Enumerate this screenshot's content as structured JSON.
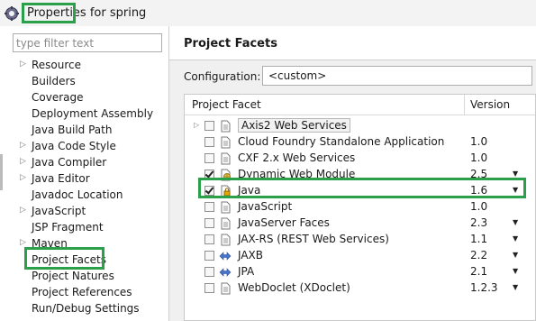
{
  "window": {
    "title": "Properties for spring",
    "icon": "eclipse-gear-icon"
  },
  "left_pane": {
    "filter_placeholder": "type filter text",
    "items": [
      {
        "label": "Resource",
        "expandable": true
      },
      {
        "label": "Builders",
        "expandable": false
      },
      {
        "label": "Coverage",
        "expandable": false
      },
      {
        "label": "Deployment Assembly",
        "expandable": false
      },
      {
        "label": "Java Build Path",
        "expandable": false
      },
      {
        "label": "Java Code Style",
        "expandable": true
      },
      {
        "label": "Java Compiler",
        "expandable": true
      },
      {
        "label": "Java Editor",
        "expandable": true
      },
      {
        "label": "Javadoc Location",
        "expandable": false
      },
      {
        "label": "JavaScript",
        "expandable": true
      },
      {
        "label": "JSP Fragment",
        "expandable": false
      },
      {
        "label": "Maven",
        "expandable": true
      },
      {
        "label": "Project Facets",
        "expandable": false,
        "selected": true
      },
      {
        "label": "Project Natures",
        "expandable": false
      },
      {
        "label": "Project References",
        "expandable": false
      },
      {
        "label": "Run/Debug Settings",
        "expandable": false
      }
    ]
  },
  "right_pane": {
    "title": "Project Facets",
    "configuration_label": "Configuration:",
    "configuration_value": "<custom>",
    "columns": {
      "facet": "Project Facet",
      "version": "Version"
    },
    "facets": [
      {
        "name": "Axis2 Web Services",
        "version": "",
        "checked": false,
        "expandable": true,
        "icon": "page-icon",
        "dropdown": false
      },
      {
        "name": "Cloud Foundry Standalone Application",
        "version": "1.0",
        "checked": false,
        "icon": "page-icon",
        "dropdown": false
      },
      {
        "name": "CXF 2.x Web Services",
        "version": "1.0",
        "checked": false,
        "icon": "page-icon",
        "dropdown": false
      },
      {
        "name": "Dynamic Web Module",
        "version": "2.5",
        "checked": true,
        "icon": "web-module-icon",
        "dropdown": true
      },
      {
        "name": "Java",
        "version": "1.6",
        "checked": true,
        "icon": "java-lock-icon",
        "dropdown": true
      },
      {
        "name": "JavaScript",
        "version": "1.0",
        "checked": false,
        "icon": "page-icon",
        "dropdown": false
      },
      {
        "name": "JavaServer Faces",
        "version": "2.3",
        "checked": false,
        "icon": "page-icon",
        "dropdown": true
      },
      {
        "name": "JAX-RS (REST Web Services)",
        "version": "1.1",
        "checked": false,
        "icon": "page-icon",
        "dropdown": true
      },
      {
        "name": "JAXB",
        "version": "2.2",
        "checked": false,
        "icon": "double-arrow-icon",
        "dropdown": true
      },
      {
        "name": "JPA",
        "version": "2.1",
        "checked": false,
        "icon": "double-arrow-icon",
        "dropdown": true
      },
      {
        "name": "WebDoclet (XDoclet)",
        "version": "1.2.3",
        "checked": false,
        "icon": "page-icon",
        "dropdown": true
      }
    ]
  },
  "colors": {
    "highlight": "#2aa04a",
    "pane_background": "#f0f0f0"
  }
}
